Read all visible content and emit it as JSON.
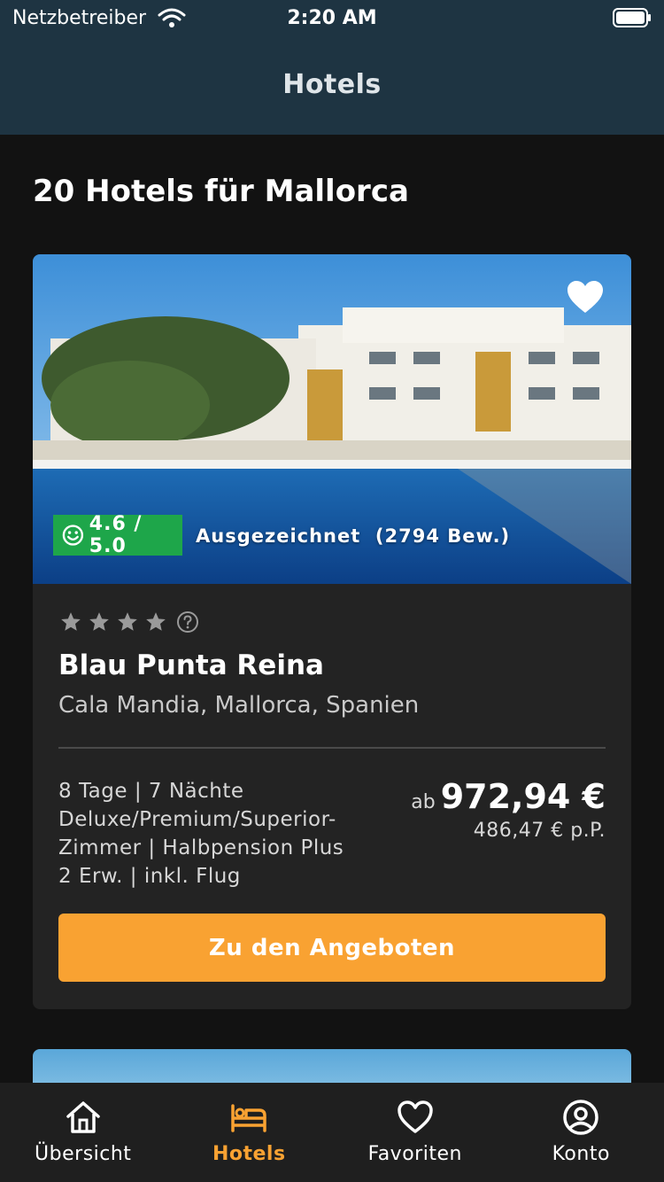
{
  "status_bar": {
    "carrier": "Netzbetreiber",
    "time": "2:20 AM"
  },
  "nav": {
    "title": "Hotels"
  },
  "list": {
    "headline": "20 Hotels für Mallorca"
  },
  "hotel": {
    "rating_score": "4.6 / 5.0",
    "rating_label": "Ausgezeichnet",
    "rating_count": "(2794 Bew.)",
    "stars": 4,
    "name": "Blau Punta Reina",
    "location": "Cala Mandia, Mallorca, Spanien",
    "details": {
      "line1": "8 Tage | 7 Nächte",
      "line2": "Deluxe/Premium/Superior-",
      "line3": "Zimmer | Halbpension Plus",
      "line4": "2 Erw. | inkl. Flug"
    },
    "price_prefix": "ab",
    "price": "972,94 €",
    "price_per_person": "486,47 € p.P.",
    "cta_label": "Zu den Angeboten",
    "favorite": true
  },
  "tabs": [
    {
      "label": "Übersicht",
      "icon": "home-icon"
    },
    {
      "label": "Hotels",
      "icon": "bed-icon",
      "active": true
    },
    {
      "label": "Favoriten",
      "icon": "heart-icon"
    },
    {
      "label": "Konto",
      "icon": "account-icon"
    }
  ],
  "colors": {
    "accent": "#f9a232",
    "header": "#1e3442",
    "rating": "#1ea64a",
    "background": "#121212",
    "card": "#232323"
  }
}
